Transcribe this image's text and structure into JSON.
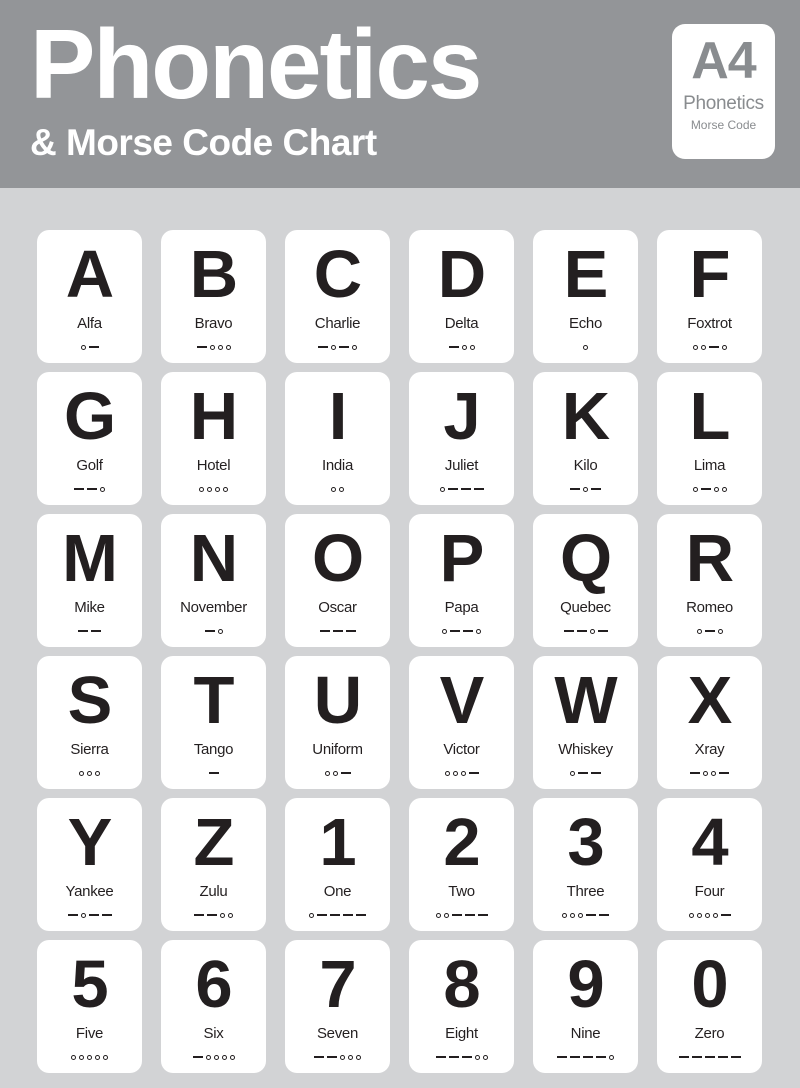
{
  "header": {
    "title": "Phonetics",
    "subtitle": "& Morse Code Chart",
    "badge": {
      "code": "A4",
      "label": "Phonetics",
      "sublabel": "Morse Code"
    },
    "background_color": "#939598",
    "text_color": "#ffffff"
  },
  "page": {
    "background_color": "#d2d3d5",
    "card_color": "#ffffff",
    "ink_color": "#231f20"
  },
  "chart_data": {
    "type": "table",
    "title": "Phonetics & Morse Code Chart",
    "columns": [
      "character",
      "word",
      "morse"
    ],
    "columns_per_row": 6,
    "rows": 6,
    "entries": [
      {
        "char": "A",
        "word": "Alfa",
        "morse": ".-"
      },
      {
        "char": "B",
        "word": "Bravo",
        "morse": "-..."
      },
      {
        "char": "C",
        "word": "Charlie",
        "morse": "-.-."
      },
      {
        "char": "D",
        "word": "Delta",
        "morse": "-.."
      },
      {
        "char": "E",
        "word": "Echo",
        "morse": "."
      },
      {
        "char": "F",
        "word": "Foxtrot",
        "morse": "..-."
      },
      {
        "char": "G",
        "word": "Golf",
        "morse": "--."
      },
      {
        "char": "H",
        "word": "Hotel",
        "morse": "...."
      },
      {
        "char": "I",
        "word": "India",
        "morse": ".."
      },
      {
        "char": "J",
        "word": "Juliet",
        "morse": ".---"
      },
      {
        "char": "K",
        "word": "Kilo",
        "morse": "-.-"
      },
      {
        "char": "L",
        "word": "Lima",
        "morse": ".-.."
      },
      {
        "char": "M",
        "word": "Mike",
        "morse": "--"
      },
      {
        "char": "N",
        "word": "November",
        "morse": "-."
      },
      {
        "char": "O",
        "word": "Oscar",
        "morse": "---"
      },
      {
        "char": "P",
        "word": "Papa",
        "morse": ".--."
      },
      {
        "char": "Q",
        "word": "Quebec",
        "morse": "--.-"
      },
      {
        "char": "R",
        "word": "Romeo",
        "morse": ".-."
      },
      {
        "char": "S",
        "word": "Sierra",
        "morse": "..."
      },
      {
        "char": "T",
        "word": "Tango",
        "morse": "-"
      },
      {
        "char": "U",
        "word": "Uniform",
        "morse": "..-"
      },
      {
        "char": "V",
        "word": "Victor",
        "morse": "...-"
      },
      {
        "char": "W",
        "word": "Whiskey",
        "morse": ".--"
      },
      {
        "char": "X",
        "word": "Xray",
        "morse": "-..-"
      },
      {
        "char": "Y",
        "word": "Yankee",
        "morse": "-.--"
      },
      {
        "char": "Z",
        "word": "Zulu",
        "morse": "--.."
      },
      {
        "char": "1",
        "word": "One",
        "morse": ".----"
      },
      {
        "char": "2",
        "word": "Two",
        "morse": "..---"
      },
      {
        "char": "3",
        "word": "Three",
        "morse": "...--"
      },
      {
        "char": "4",
        "word": "Four",
        "morse": "....-"
      },
      {
        "char": "5",
        "word": "Five",
        "morse": "....."
      },
      {
        "char": "6",
        "word": "Six",
        "morse": "-...."
      },
      {
        "char": "7",
        "word": "Seven",
        "morse": "--..."
      },
      {
        "char": "8",
        "word": "Eight",
        "morse": "---.."
      },
      {
        "char": "9",
        "word": "Nine",
        "morse": "----."
      },
      {
        "char": "0",
        "word": "Zero",
        "morse": "-----"
      }
    ]
  }
}
